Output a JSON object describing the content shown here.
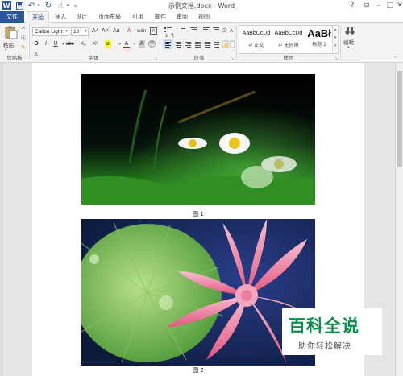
{
  "window": {
    "title": "示例文档.docx - Word",
    "controls": {
      "help": "?",
      "minimize": "–",
      "maximize": "□",
      "close": "✕"
    }
  },
  "quick_access": [
    "word-logo-icon",
    "save-icon",
    "undo-icon",
    "redo-icon",
    "touch-mode-icon",
    "customize-icon"
  ],
  "tabs": [
    "文件",
    "开始",
    "插入",
    "设计",
    "页面布局",
    "引用",
    "邮件",
    "审阅",
    "视图"
  ],
  "active_tab": "开始",
  "ribbon": {
    "clipboard": {
      "paste_label": "粘贴",
      "group_label": "剪贴板"
    },
    "font": {
      "font_name": "Calibri Light",
      "font_size": "10",
      "grow": "A˄",
      "shrink": "A˅",
      "case": "Aa",
      "clear": "A",
      "wen": "wén",
      "bold": "B",
      "italic": "I",
      "underline": "U",
      "strike": "abc",
      "subscript": "X₂",
      "superscript": "X²",
      "effects": "A",
      "highlight": "ab",
      "color": "A",
      "shading": "A",
      "border": "A",
      "group_label": "字体"
    },
    "paragraph": {
      "group_label": "段落"
    },
    "styles": {
      "items": [
        {
          "sample": "AaBbCcDd",
          "name": "↵ 正文"
        },
        {
          "sample": "AaBbCcDd",
          "name": "↵ 无间隔"
        },
        {
          "sample": "AaBł",
          "name": "标题 1"
        }
      ],
      "group_label": "样式"
    },
    "editing": {
      "label": "编辑"
    }
  },
  "document": {
    "figure1_caption": "图 1",
    "figure2_caption": "图 2"
  },
  "watermark": {
    "big": "百科全说",
    "small": "助你轻松解决"
  },
  "colors": {
    "accent": "#2b579a",
    "watermark_green": "#0a8f4a"
  }
}
